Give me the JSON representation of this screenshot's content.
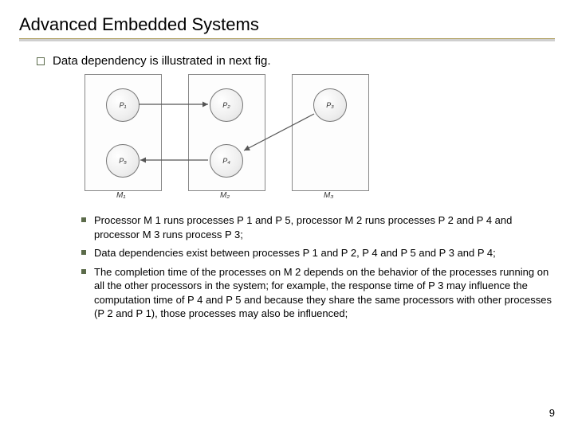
{
  "title": "Advanced Embedded Systems",
  "intro": "Data dependency is illustrated in next fig.",
  "figure": {
    "boxes": {
      "m1": {
        "label": "M₁",
        "p_top": "P₁",
        "p_bottom": "P₅"
      },
      "m2": {
        "label": "M₂",
        "p_top": "P₂",
        "p_bottom": "P₄"
      },
      "m3": {
        "label": "M₃",
        "p_top": "P₃"
      }
    }
  },
  "bullets": [
    "Processor M 1 runs processes P 1 and P 5, processor M 2 runs processes P 2 and P 4 and processor M 3 runs process P 3;",
    "Data dependencies exist between processes P 1 and P 2, P 4 and P 5 and P 3 and P 4;",
    "The completion time of the processes on M 2 depends on the behavior of the processes running on all the other processors in the system; for example, the response time of P 3 may influence the computation time of P 4 and P 5 and because they share the same processors with other processes (P 2 and P 1), those processes may also be influenced;"
  ],
  "page_number": "9"
}
